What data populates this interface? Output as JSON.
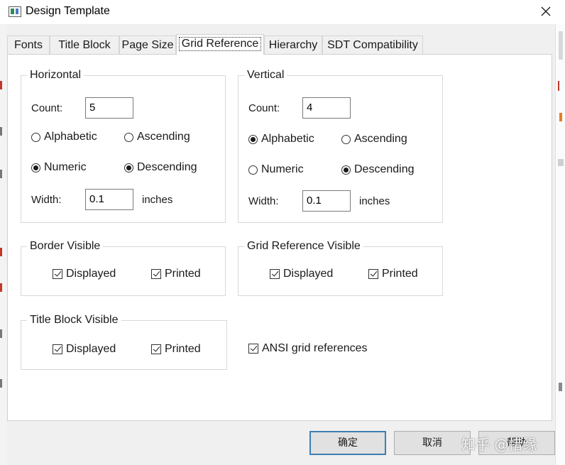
{
  "window": {
    "title": "Design Template",
    "close_glyph": "✕",
    "app_icon": "window-icon"
  },
  "tabs": [
    {
      "label": "Fonts",
      "active": false
    },
    {
      "label": "Title Block",
      "active": false
    },
    {
      "label": "Page Size",
      "active": false
    },
    {
      "label": "Grid Reference",
      "active": true
    },
    {
      "label": "Hierarchy",
      "active": false
    },
    {
      "label": "SDT Compatibility",
      "active": false
    }
  ],
  "horizontal": {
    "title": "Horizontal",
    "count_label": "Count:",
    "count_value": "5",
    "alphabetic_label": "Alphabetic",
    "numeric_label": "Numeric",
    "ascending_label": "Ascending",
    "descending_label": "Descending",
    "label_type": "Numeric",
    "order": "Descending",
    "width_label": "Width:",
    "width_value": "0.1",
    "width_unit": "inches"
  },
  "vertical": {
    "title": "Vertical",
    "count_label": "Count:",
    "count_value": "4",
    "alphabetic_label": "Alphabetic",
    "numeric_label": "Numeric",
    "ascending_label": "Ascending",
    "descending_label": "Descending",
    "label_type": "Alphabetic",
    "order": "Descending",
    "width_label": "Width:",
    "width_value": "0.1",
    "width_unit": "inches"
  },
  "border_visible": {
    "title": "Border Visible",
    "displayed_label": "Displayed",
    "displayed": true,
    "printed_label": "Printed",
    "printed": true
  },
  "grid_reference_visible": {
    "title": "Grid Reference Visible",
    "displayed_label": "Displayed",
    "displayed": true,
    "printed_label": "Printed",
    "printed": true
  },
  "title_block_visible": {
    "title": "Title Block Visible",
    "displayed_label": "Displayed",
    "displayed": true,
    "printed_label": "Printed",
    "printed": true
  },
  "ansi": {
    "label": "ANSI grid references",
    "checked": true
  },
  "buttons": {
    "ok": "确定",
    "cancel": "取消",
    "help": "帮助"
  },
  "watermark": "知乎 @惜缘",
  "colors": {
    "dialog_bg": "#f0f0f0",
    "panel_bg": "#ffffff",
    "default_button_border": "#3c7fb1",
    "side_marks": "#c0392b"
  }
}
